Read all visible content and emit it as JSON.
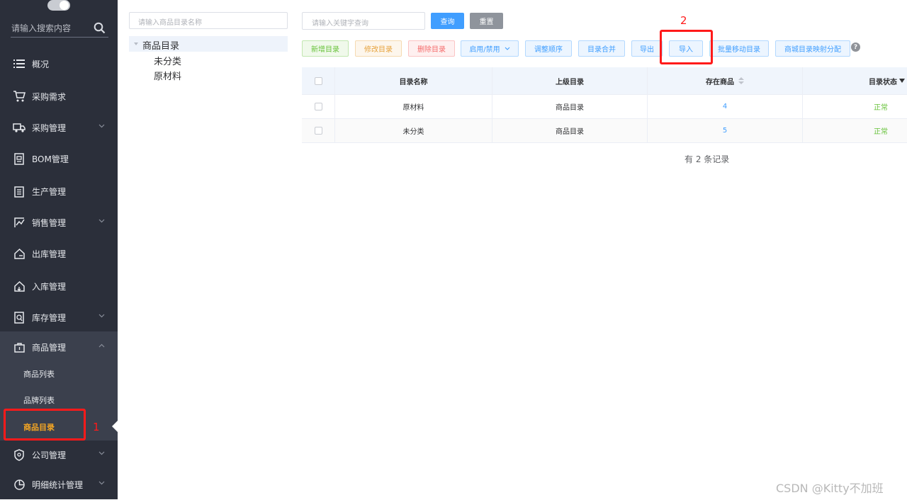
{
  "sidebar": {
    "search_placeholder": "请输入搜索内容",
    "items": [
      {
        "label": "概况"
      },
      {
        "label": "采购需求"
      },
      {
        "label": "采购管理"
      },
      {
        "label": "BOM管理"
      },
      {
        "label": "生产管理"
      },
      {
        "label": "销售管理"
      },
      {
        "label": "出库管理"
      },
      {
        "label": "入库管理"
      },
      {
        "label": "库存管理"
      },
      {
        "label": "商品管理"
      },
      {
        "label": "公司管理"
      },
      {
        "label": "明细统计管理"
      }
    ],
    "submenu": [
      {
        "label": "商品列表"
      },
      {
        "label": "品牌列表"
      },
      {
        "label": "商品目录"
      }
    ]
  },
  "tree": {
    "search_placeholder": "请输入商品目录名称",
    "root": "商品目录",
    "children": [
      "未分类",
      "原材料"
    ]
  },
  "search": {
    "placeholder": "请输入关键字查询",
    "query_label": "查询",
    "reset_label": "重置"
  },
  "toolbar": {
    "add": "新增目录",
    "edit": "修改目录",
    "delete": "删除目录",
    "toggle": "启用/禁用",
    "reorder": "调整顺序",
    "merge": "目录合并",
    "export": "导出",
    "import": "导入",
    "batch_move": "批量移动目录",
    "mall_map": "商城目录映射分配"
  },
  "table": {
    "headers": {
      "name": "目录名称",
      "parent": "上级目录",
      "goods": "存在商品",
      "status": "目录状态"
    },
    "rows": [
      {
        "name": "原材料",
        "parent": "商品目录",
        "goods": "4",
        "status": "正常"
      },
      {
        "name": "未分类",
        "parent": "商品目录",
        "goods": "5",
        "status": "正常"
      }
    ]
  },
  "record_count": "有 2 条记录",
  "annotations": {
    "mark1": "1",
    "mark2": "2"
  },
  "watermark": "CSDN @Kitty不加班",
  "colors": {
    "sidebar_bg": "#2b2f3a",
    "active_menu": "#f5a623",
    "primary": "#409eff",
    "highlight": "#ff1a1a"
  }
}
